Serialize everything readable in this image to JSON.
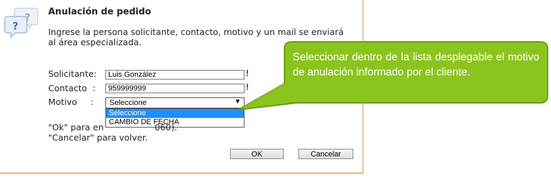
{
  "dialog": {
    "title": "Anulación de pedido",
    "message": "Ingrese la persona solicitante, contacto, motivo y un mail se enviará al área especializada.",
    "fields": {
      "solicitante_label": "Solicitante:",
      "solicitante_value": "Luis González",
      "contacto_label": "Contacto  :",
      "contacto_value": "959999999",
      "motivo_label": "Motivo     :",
      "motivo_value": "Seleccione",
      "required_mark": "!"
    },
    "dropdown_options": [
      "Seleccione",
      "CAMBIO DE FECHA"
    ],
    "footer_line1_start": "\"Ok\" para en",
    "footer_line1_end": "060).",
    "footer_line2": "\"Cancelar\" para volver.",
    "ok_label": "OK",
    "cancel_label": "Cancelar"
  },
  "callout": {
    "text": "Seleccionar dentro de la lista desplegable el motivo de anulación informado por el cliente."
  },
  "colors": {
    "callout_fill": "#8cc41e",
    "required": "#e00000",
    "selection": "#1e90ff"
  }
}
